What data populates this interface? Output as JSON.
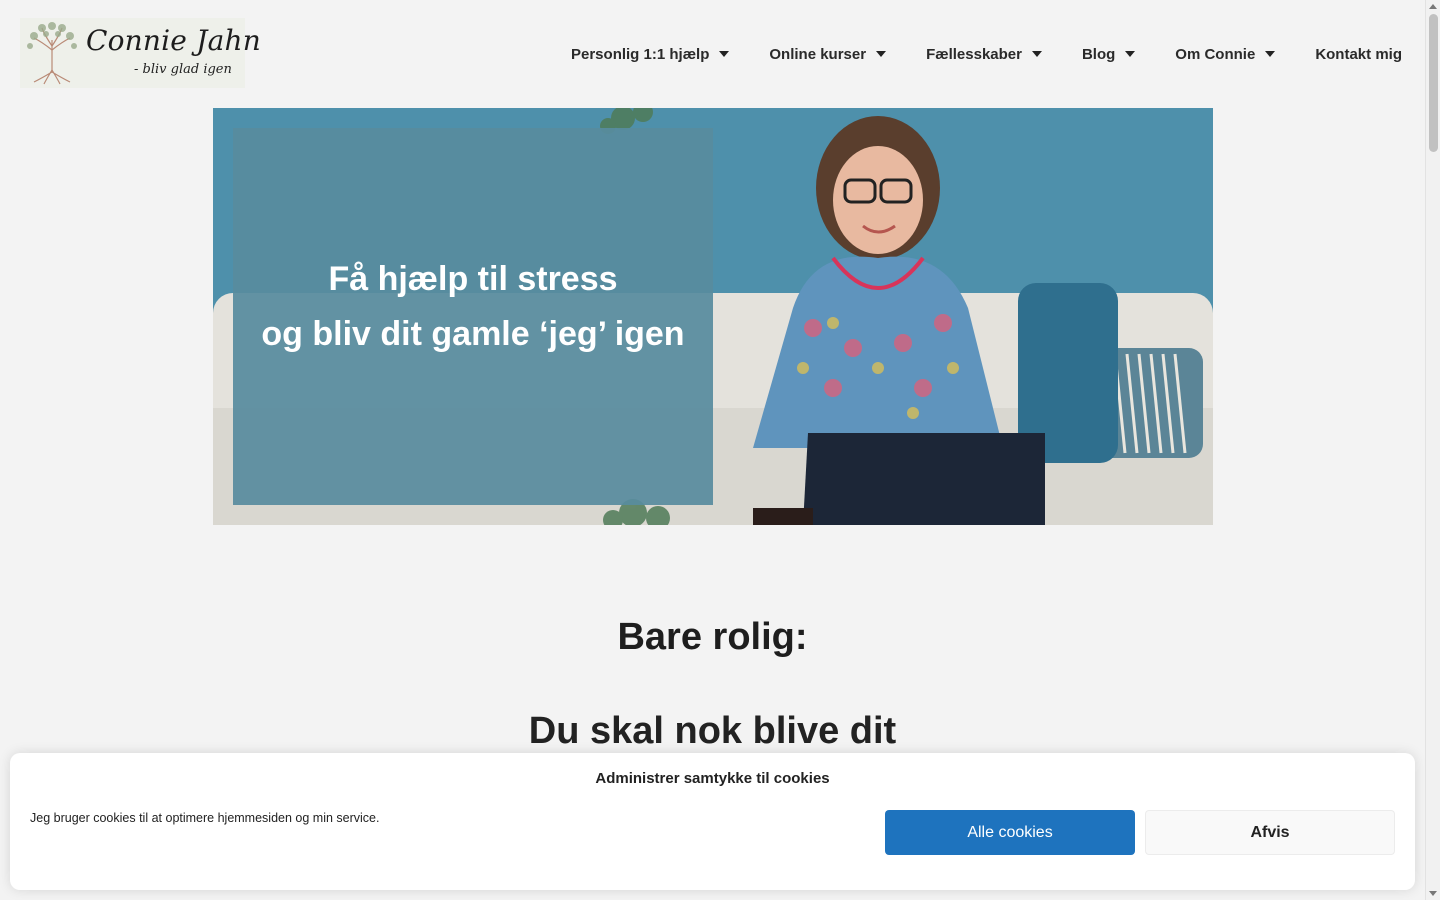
{
  "brand": {
    "name": "Connie Jahn",
    "tagline": "- bliv glad igen",
    "logo_icon": "tree-icon"
  },
  "nav": {
    "items": [
      {
        "label": "Personlig 1:1 hjælp",
        "has_dropdown": true
      },
      {
        "label": "Online kurser",
        "has_dropdown": true
      },
      {
        "label": "Fællesskaber",
        "has_dropdown": true
      },
      {
        "label": "Blog",
        "has_dropdown": true
      },
      {
        "label": "Om Connie",
        "has_dropdown": true
      },
      {
        "label": "Kontakt mig",
        "has_dropdown": false
      }
    ]
  },
  "hero": {
    "line1": "Få hjælp til stress",
    "line2": "og bliv dit gamle ‘jeg’ igen"
  },
  "content": {
    "subtitle": "Bare rolig:",
    "headline": "Du skal nok blive dit"
  },
  "cookie": {
    "title": "Administrer samtykke til cookies",
    "body": "Jeg bruger cookies til at optimere hjemmesiden og min service.",
    "accept_label": "Alle cookies",
    "deny_label": "Afvis"
  },
  "colors": {
    "page_bg": "#f3f3f3",
    "hero_overlay": "#588c9e",
    "accept_button": "#1e73be"
  }
}
